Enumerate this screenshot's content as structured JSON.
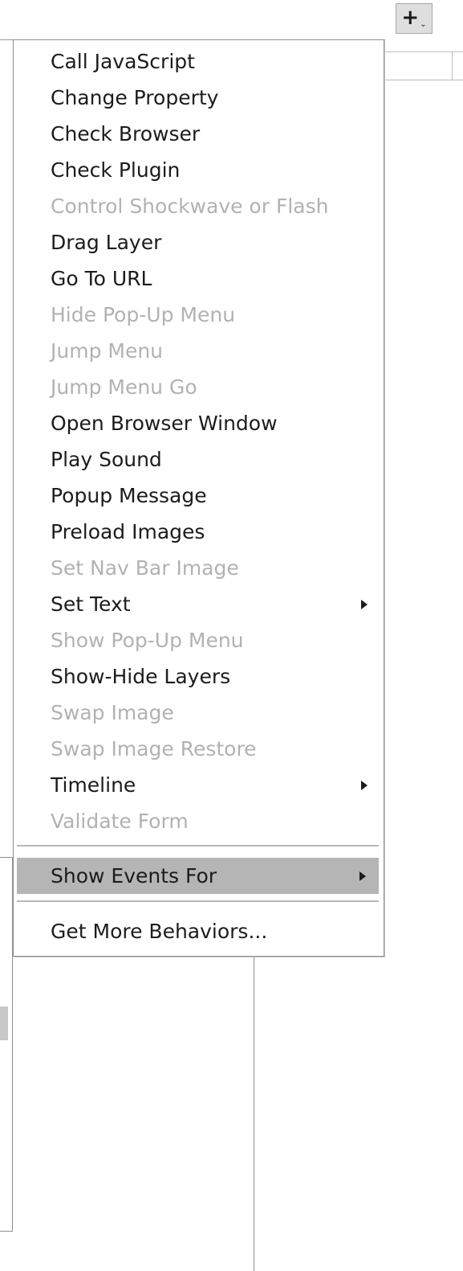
{
  "toolbar": {
    "add_behavior_label": "+",
    "add_behavior_caret": "⌄"
  },
  "menu": {
    "items": [
      {
        "label": "Call JavaScript",
        "enabled": true,
        "submenu": false
      },
      {
        "label": "Change Property",
        "enabled": true,
        "submenu": false
      },
      {
        "label": "Check Browser",
        "enabled": true,
        "submenu": false
      },
      {
        "label": "Check Plugin",
        "enabled": true,
        "submenu": false
      },
      {
        "label": "Control Shockwave or Flash",
        "enabled": false,
        "submenu": false
      },
      {
        "label": "Drag Layer",
        "enabled": true,
        "submenu": false
      },
      {
        "label": "Go To URL",
        "enabled": true,
        "submenu": false
      },
      {
        "label": "Hide Pop-Up Menu",
        "enabled": false,
        "submenu": false
      },
      {
        "label": "Jump Menu",
        "enabled": false,
        "submenu": false
      },
      {
        "label": "Jump Menu Go",
        "enabled": false,
        "submenu": false
      },
      {
        "label": "Open Browser Window",
        "enabled": true,
        "submenu": false
      },
      {
        "label": "Play Sound",
        "enabled": true,
        "submenu": false
      },
      {
        "label": "Popup Message",
        "enabled": true,
        "submenu": false
      },
      {
        "label": "Preload Images",
        "enabled": true,
        "submenu": false
      },
      {
        "label": "Set Nav Bar Image",
        "enabled": false,
        "submenu": false
      },
      {
        "label": "Set Text",
        "enabled": true,
        "submenu": true
      },
      {
        "label": "Show Pop-Up Menu",
        "enabled": false,
        "submenu": false
      },
      {
        "label": "Show-Hide Layers",
        "enabled": true,
        "submenu": false
      },
      {
        "label": "Swap Image",
        "enabled": false,
        "submenu": false
      },
      {
        "label": "Swap Image Restore",
        "enabled": false,
        "submenu": false
      },
      {
        "label": "Timeline",
        "enabled": true,
        "submenu": true
      },
      {
        "label": "Validate Form",
        "enabled": false,
        "submenu": false
      }
    ],
    "show_events_for": {
      "label": "Show Events For",
      "submenu": true,
      "highlighted": true
    },
    "get_more_behaviors": {
      "label": "Get More Behaviors..."
    }
  },
  "colors": {
    "enabled_text": "#1c1c1c",
    "disabled_text": "#b2b2b2",
    "highlight_bg": "#b5b5b5",
    "menu_border": "#8f8f8f"
  }
}
